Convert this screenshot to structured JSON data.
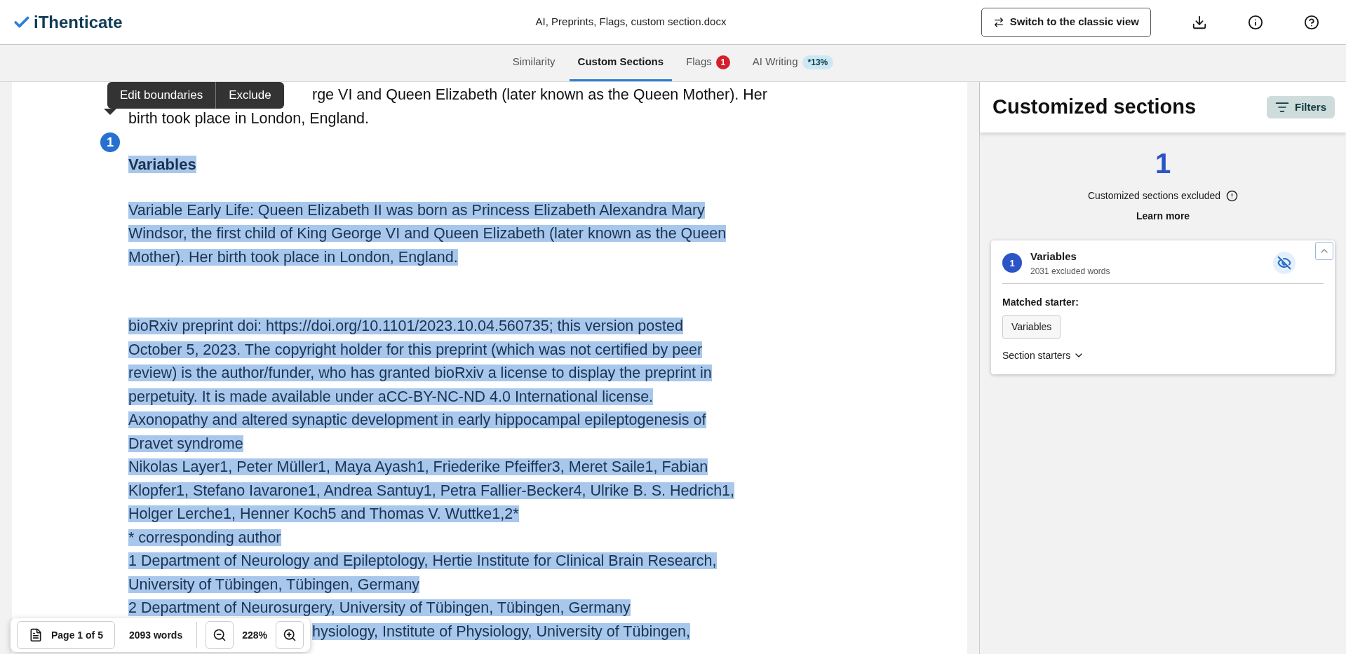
{
  "header": {
    "brand": "iThenticate",
    "file_name": "AI, Preprints, Flags, custom section.docx",
    "switch_button": "Switch to the classic view"
  },
  "tabs": [
    {
      "label": "Similarity",
      "selected": false,
      "kind": "plain"
    },
    {
      "label": "Custom Sections",
      "selected": true,
      "kind": "plain"
    },
    {
      "label": "Flags",
      "selected": false,
      "kind": "alert",
      "badge": "1"
    },
    {
      "label": "AI Writing",
      "selected": false,
      "kind": "info",
      "badge": "*13%"
    }
  ],
  "popover": {
    "actions": [
      "Edit boundaries",
      "Exclude"
    ]
  },
  "section_marker": "1",
  "document": {
    "paragraphs": [
      {
        "kind": "continuation",
        "highlighted": false,
        "lines": [
          "rge VI and Queen Elizabeth (later known as the Queen Mother). Her",
          "birth took place in London, England."
        ]
      },
      {
        "kind": "heading",
        "highlighted": true,
        "lines": [
          "Variables"
        ]
      },
      {
        "kind": "text",
        "highlighted": true,
        "lines": [
          "Variable Early Life: Queen Elizabeth II was born as Princess Elizabeth Alexandra Mary",
          "Windsor, the first child of King George VI and Queen Elizabeth (later known as the Queen",
          "Mother). Her birth took place in London, England."
        ]
      },
      {
        "kind": "text_after_gap",
        "highlighted": true,
        "lines": [
          "bioRxiv preprint doi: https://doi.org/10.1101/2023.10.04.560735; this version posted",
          "October 5, 2023. The copyright holder for this preprint (which was not certified by peer",
          "review) is the author/funder, who has granted bioRxiv a license to display the preprint in",
          "perpetuity. It is made available under aCC-BY-NC-ND 4.0 International license.",
          "Axonopathy and altered synaptic development in early hippocampal epileptogenesis of",
          "Dravet syndrome",
          "Nikolas Layer1, Peter Müller1, Maya Ayash1, Friederike Pfeiffer3, Meret Saile1, Fabian",
          "Klopfer1, Stefano Iavarone1, Andrea Santuy1, Petra Fallier-Becker4, Ulrike B. S. Hedrich1,",
          "Holger Lerche1, Henner Koch5 and Thomas V. Wuttke1,2*",
          "* corresponding author",
          "1 Department of Neurology and Epileptology, Hertie Institute for Clinical Brain Research,",
          "University of Tübingen, Tübingen, Germany",
          "2 Department of Neurosurgery, University of Tübingen, Tübingen, Germany"
        ]
      },
      {
        "kind": "continuation",
        "highlighted": true,
        "lines": [
          "hysiology, Institute of Physiology, University of Tübingen,"
        ]
      }
    ]
  },
  "toolbar": {
    "page": "Page 1 of 5",
    "words": "2093 words",
    "zoom": "228%"
  },
  "panel": {
    "title": "Customized sections",
    "filters_button": "Filters",
    "count": "1",
    "count_label": "Customized sections excluded",
    "learn_more": "Learn more",
    "sections": [
      {
        "number": "1",
        "name": "Variables",
        "excluded": "2031 excluded words",
        "expanded": true,
        "matched_label": "Matched starter:",
        "matched": [
          "Variables"
        ],
        "starters_toggle": "Section starters"
      }
    ]
  }
}
